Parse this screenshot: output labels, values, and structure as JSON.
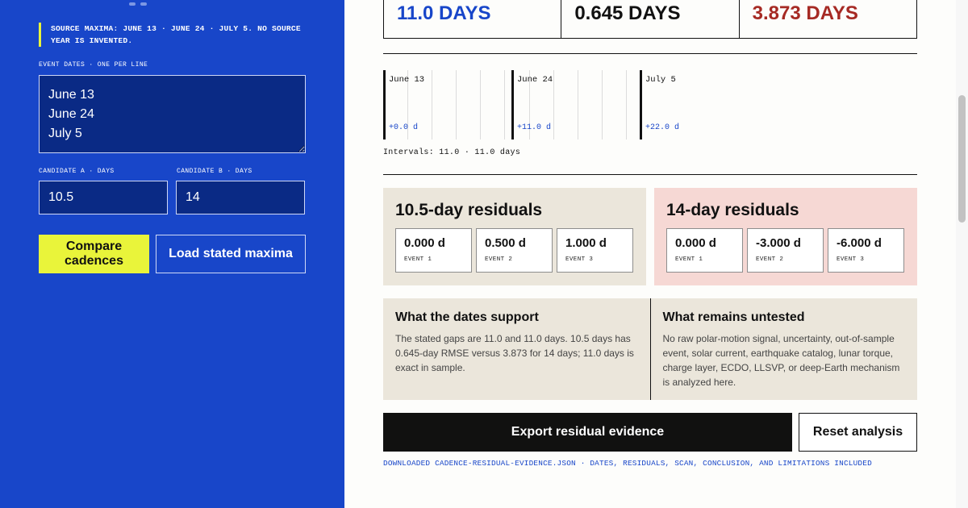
{
  "source_note": "Source maxima: June 13 · June 24 · July 5. No source year is invented.",
  "event_dates": {
    "label": "Event dates · one per line",
    "value": "June 13\nJune 24\nJuly 5"
  },
  "candidate_a": {
    "label": "Candidate A · days",
    "value": "10.5"
  },
  "candidate_b": {
    "label": "Candidate B · days",
    "value": "14"
  },
  "buttons": {
    "compare": "Compare cadences",
    "load": "Load stated maxima",
    "export": "Export residual evidence",
    "reset": "Reset analysis"
  },
  "stats": [
    {
      "value": "11.0 DAYS",
      "color": "#1846c9"
    },
    {
      "value": "0.645 DAYS",
      "color": "#111111"
    },
    {
      "value": "3.873 DAYS",
      "color": "#a62a24"
    }
  ],
  "timeline": {
    "events": [
      {
        "date": "June 13",
        "offset": "+0.0 d",
        "day": 0
      },
      {
        "date": "June 24",
        "offset": "+11.0 d",
        "day": 11
      },
      {
        "date": "July 5",
        "offset": "+22.0 d",
        "day": 22
      }
    ],
    "intervals": "Intervals: 11.0 · 11.0 days"
  },
  "residuals_a": {
    "title": "10.5-day residuals",
    "cards": [
      {
        "value": "0.000 d",
        "label": "Event 1"
      },
      {
        "value": "0.500 d",
        "label": "Event 2"
      },
      {
        "value": "1.000 d",
        "label": "Event 3"
      }
    ]
  },
  "residuals_b": {
    "title": "14-day residuals",
    "cards": [
      {
        "value": "0.000 d",
        "label": "Event 1"
      },
      {
        "value": "-3.000 d",
        "label": "Event 2"
      },
      {
        "value": "-6.000 d",
        "label": "Event 3"
      }
    ]
  },
  "notes": {
    "supported": {
      "title": "What the dates support",
      "body": "The stated gaps are 11.0 and 11.0 days. 10.5 days has 0.645-day RMSE versus 3.873 for 14 days; 11.0 days is exact in sample."
    },
    "untested": {
      "title": "What remains untested",
      "body": "No raw polar-motion signal, uncertainty, out-of-sample event, solar current, earthquake catalog, lunar torque, charge layer, ECDO, LLSVP, or deep-Earth mechanism is analyzed here."
    }
  },
  "download_note": "Downloaded cadence-residual-evidence.json · dates, residuals, scan, conclusion, and limitations included"
}
